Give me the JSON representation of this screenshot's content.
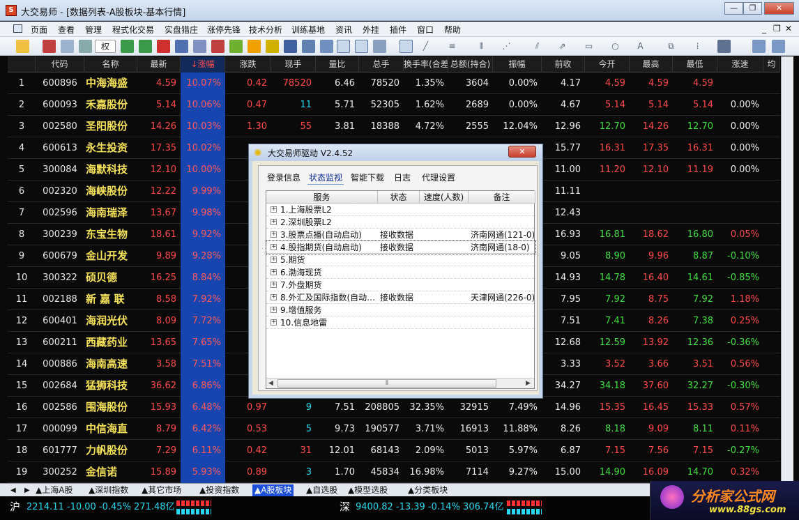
{
  "window": {
    "title": "大交易师 - [数据列表-A股板块-基本行情]",
    "icon": "S",
    "min_glyph": "—",
    "max_glyph": "❐",
    "close_glyph": "✕"
  },
  "menu": [
    "页面",
    "查看",
    "管理",
    "程式化交易",
    "实盘猎庄",
    "涨停先锋",
    "技术分析",
    "训练基地",
    "资讯",
    "外挂",
    "插件",
    "窗口",
    "帮助"
  ],
  "menu_right": [
    "_",
    "❐",
    "✕"
  ],
  "toolbar": {
    "combo_label": "权"
  },
  "columns": [
    "",
    "代码",
    "名称",
    "最新",
    "↓涨幅",
    "涨跌",
    "现手",
    "量比",
    "总手",
    "换手率(合差",
    "总额(持合)",
    "振幅",
    "前收",
    "今开",
    "最高",
    "最低",
    "涨速",
    "均"
  ],
  "rows": [
    [
      "1",
      "600896",
      "中海海盛",
      "4.59",
      "10.07%",
      "0.42",
      "78520",
      "6.46",
      "78520",
      "1.35%",
      "3604",
      "0.00%",
      "4.17",
      "4.59",
      "4.59",
      "4.59",
      ""
    ],
    [
      "2",
      "600093",
      "禾嘉股份",
      "5.14",
      "10.06%",
      "0.47",
      "11",
      "5.71",
      "52305",
      "1.62%",
      "2689",
      "0.00%",
      "4.67",
      "5.14",
      "5.14",
      "5.14",
      "0.00%"
    ],
    [
      "3",
      "002580",
      "圣阳股份",
      "14.26",
      "10.03%",
      "1.30",
      "55",
      "3.81",
      "18388",
      "4.72%",
      "2555",
      "12.04%",
      "12.96",
      "12.70",
      "14.26",
      "12.70",
      "0.00%"
    ],
    [
      "4",
      "600613",
      "永生投资",
      "17.35",
      "10.02%",
      "",
      "",
      "",
      "",
      "",
      "",
      "",
      "15.77",
      "16.31",
      "17.35",
      "16.31",
      "0.00%"
    ],
    [
      "5",
      "300084",
      "海默科技",
      "12.10",
      "10.00%",
      "",
      "",
      "",
      "",
      "",
      "",
      "",
      "11.00",
      "11.20",
      "12.10",
      "11.19",
      "0.00%"
    ],
    [
      "6",
      "002320",
      "海峡股份",
      "12.22",
      "9.99%",
      "",
      "",
      "",
      "",
      "",
      "",
      "",
      "11.11",
      "",
      "",
      "",
      ""
    ],
    [
      "7",
      "002596",
      "海南瑞泽",
      "13.67",
      "9.98%",
      "",
      "",
      "",
      "",
      "",
      "",
      "",
      "12.43",
      "",
      "",
      "",
      ""
    ],
    [
      "8",
      "300239",
      "东宝生物",
      "18.61",
      "9.92%",
      "",
      "",
      "",
      "",
      "",
      "",
      "",
      "16.93",
      "16.81",
      "18.62",
      "16.80",
      "0.05%"
    ],
    [
      "9",
      "600679",
      "金山开发",
      "9.89",
      "9.28%",
      "",
      "",
      "",
      "",
      "",
      "",
      "",
      "9.05",
      "8.90",
      "9.96",
      "8.87",
      "-0.10%"
    ],
    [
      "10",
      "300322",
      "硕贝德",
      "16.25",
      "8.84%",
      "",
      "",
      "",
      "",
      "",
      "",
      "",
      "14.93",
      "14.78",
      "16.40",
      "14.61",
      "-0.85%"
    ],
    [
      "11",
      "002188",
      "新 嘉 联",
      "8.58",
      "7.92%",
      "",
      "",
      "",
      "",
      "",
      "",
      "",
      "7.95",
      "7.92",
      "8.75",
      "7.92",
      "1.18%"
    ],
    [
      "12",
      "600401",
      "海润光伏",
      "8.09",
      "7.72%",
      "",
      "",
      "",
      "",
      "",
      "",
      "",
      "7.51",
      "7.41",
      "8.26",
      "7.38",
      "0.25%"
    ],
    [
      "13",
      "600211",
      "西藏药业",
      "13.65",
      "7.65%",
      "",
      "",
      "",
      "",
      "",
      "",
      "",
      "12.68",
      "12.59",
      "13.92",
      "12.36",
      "-0.36%"
    ],
    [
      "14",
      "000886",
      "海南高速",
      "3.58",
      "7.51%",
      "",
      "",
      "",
      "",
      "",
      "",
      "",
      "3.33",
      "3.52",
      "3.66",
      "3.51",
      "0.56%"
    ],
    [
      "15",
      "002684",
      "猛狮科技",
      "36.62",
      "6.86%",
      "",
      "",
      "",
      "",
      "",
      "",
      "",
      "34.27",
      "34.18",
      "37.60",
      "32.27",
      "-0.30%"
    ],
    [
      "16",
      "002586",
      "围海股份",
      "15.93",
      "6.48%",
      "0.97",
      "9",
      "7.51",
      "208805",
      "32.35%",
      "32915",
      "7.49%",
      "14.96",
      "15.35",
      "16.45",
      "15.33",
      "0.57%"
    ],
    [
      "17",
      "000099",
      "中信海直",
      "8.79",
      "6.42%",
      "0.53",
      "5",
      "9.73",
      "190577",
      "3.71%",
      "16913",
      "11.88%",
      "8.26",
      "8.18",
      "9.09",
      "8.11",
      "0.11%"
    ],
    [
      "18",
      "601777",
      "力帆股份",
      "7.29",
      "6.11%",
      "0.42",
      "31",
      "12.01",
      "68143",
      "2.09%",
      "5013",
      "5.97%",
      "6.87",
      "7.15",
      "7.56",
      "7.15",
      "-0.27%"
    ],
    [
      "19",
      "300252",
      "金信诺",
      "15.89",
      "5.93%",
      "0.89",
      "3",
      "1.70",
      "45834",
      "16.98%",
      "7114",
      "9.27%",
      "15.00",
      "14.90",
      "16.09",
      "14.70",
      "0.32%"
    ]
  ],
  "sheet_tabs": [
    "▲上海A股",
    "▲深圳指数",
    "▲其它市场",
    "▲投资指数",
    "▲A股板块",
    "▲自选股",
    "▲模型选股",
    "▲分类板块"
  ],
  "status": {
    "sh_label": "沪",
    "sh_values": "2214.11 -10.00 -0.45% 271.48亿",
    "sz_label": "深",
    "sz_values": "9400.82 -13.39 -0.14% 306.74亿"
  },
  "logo": {
    "text": "分析家公式网",
    "url": "www.88gs.com"
  },
  "dialog": {
    "title": "大交易师驱动 V2.4.52",
    "close": "✕",
    "tabs": [
      "登录信息",
      "状态监视",
      "智能下载",
      "日志",
      "代理设置"
    ],
    "active_tab": 1,
    "headers": [
      "服务",
      "状态",
      "速度(人数)",
      "备注"
    ],
    "items": [
      [
        "1.上海股票L2",
        "",
        "",
        ""
      ],
      [
        "2.深圳股票L2",
        "",
        "",
        ""
      ],
      [
        "3.股票点播(自动启动)",
        "接收数据",
        "",
        "济南网通(121-0)"
      ],
      [
        "4.股指期货(自动启动)",
        "接收数据",
        "",
        "济南网通(18-0)"
      ],
      [
        "5.期货",
        "",
        "",
        ""
      ],
      [
        "6.渤海现货",
        "",
        "",
        ""
      ],
      [
        "7.外盘期货",
        "",
        "",
        ""
      ],
      [
        "8.外汇及国际指数(自动…",
        "接收数据",
        "",
        "天津网通(226-0)"
      ],
      [
        "9.增值服务",
        "",
        "",
        ""
      ],
      [
        "10.信息地雷",
        "",
        "",
        ""
      ]
    ],
    "scroll_grip": "⦀"
  }
}
